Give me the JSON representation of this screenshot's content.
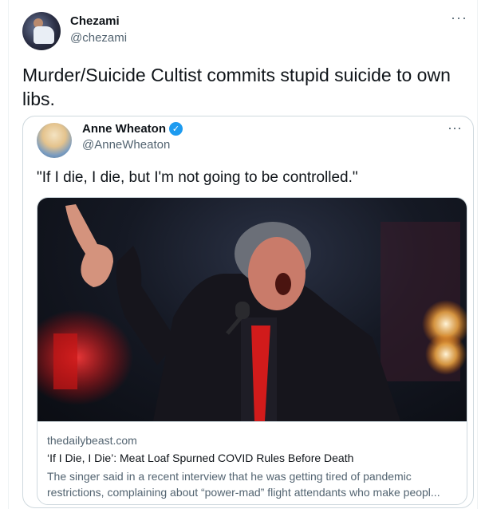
{
  "tweet": {
    "author_name": "Chezami",
    "author_handle": "@chezami",
    "more_label": "···",
    "text": "Murder/Suicide Cultist commits stupid suicide to own libs."
  },
  "quoted_tweet": {
    "author_name": "Anne Wheaton",
    "verified": true,
    "verified_mark": "✓",
    "author_handle": "@AnneWheaton",
    "more_label": "···",
    "text": "\"If I die, I die, but I'm not going to be controlled.\"",
    "link_card": {
      "domain": "thedailybeast.com",
      "title": "‘If I Die, I Die’: Meat Loaf Spurned COVID Rules Before Death",
      "description_line1": "The singer said in a recent interview that he was getting tired of pandemic",
      "description_line2": "restrictions, complaining about “power-mad” flight attendants who make peopl..."
    }
  },
  "colors": {
    "accent": "#1d9bf0",
    "text": "#0f1419",
    "secondary": "#536471",
    "border": "#cfd9de"
  }
}
